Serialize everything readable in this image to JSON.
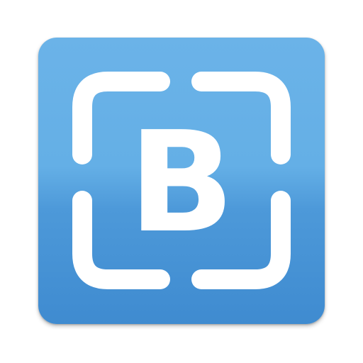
{
  "icon": {
    "letter": "B",
    "colors": {
      "background_top": "#6bb3e8",
      "background_bottom": "#3f8bd0",
      "foreground": "#ffffff"
    }
  }
}
